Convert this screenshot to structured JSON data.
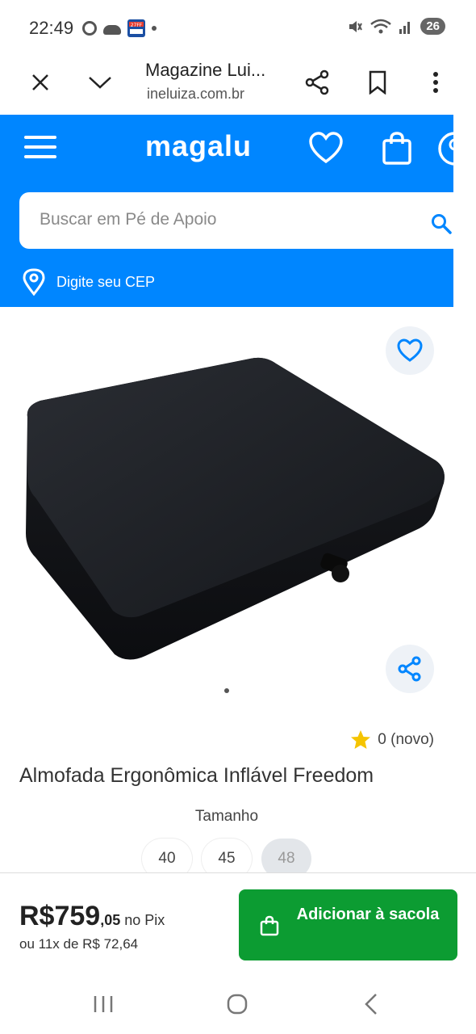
{
  "status_bar": {
    "time": "22:49",
    "battery": "26",
    "app_icon_text": "27FF"
  },
  "browser": {
    "title": "Magazine Lui...",
    "url": "ineluiza.com.br"
  },
  "header": {
    "logo": "magalu",
    "search_placeholder": "Buscar em Pé de Apoio",
    "cep_text": "Digite seu CEP",
    "brand_color": "#0086ff"
  },
  "product": {
    "rating": "0 (novo)",
    "title": "Almofada Ergonômica Inflável Freedom",
    "size_label": "Tamanho",
    "sizes": [
      "40",
      "45",
      "48"
    ],
    "selected_size": "48"
  },
  "purchase": {
    "price_int": "R$759",
    "price_cents": ",05",
    "price_suffix": " no Pix",
    "installments": "ou 11x de R$ 72,64",
    "add_label": "Adicionar à sacola",
    "button_color": "#0c9c32"
  }
}
